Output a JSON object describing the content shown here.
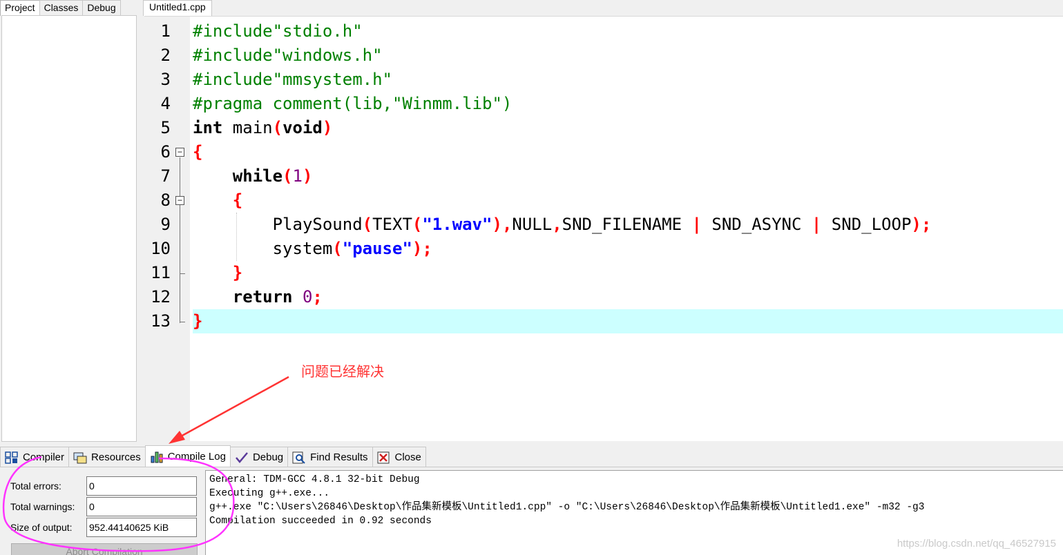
{
  "left_tabs": [
    "Project",
    "Classes",
    "Debug"
  ],
  "file_tab": "Untitled1.cpp",
  "editor": {
    "line_numbers": [
      "1",
      "2",
      "3",
      "4",
      "5",
      "6",
      "7",
      "8",
      "9",
      "10",
      "11",
      "12",
      "13"
    ]
  },
  "annotation": "问题已经解决",
  "bottom_tabs": [
    "Compiler",
    "Resources",
    "Compile Log",
    "Debug",
    "Find Results",
    "Close"
  ],
  "stats": {
    "errors_label": "Total errors:",
    "errors_value": "0",
    "warnings_label": "Total warnings:",
    "warnings_value": "0",
    "output_label": "Size of output:",
    "output_value": "952.44140625 KiB",
    "abort_label": "Abort Compilation"
  },
  "log": {
    "line1": "General: TDM-GCC 4.8.1 32-bit Debug",
    "line2": "Executing g++.exe...",
    "line3": "g++.exe \"C:\\Users\\26846\\Desktop\\作品集新模板\\Untitled1.cpp\" -o \"C:\\Users\\26846\\Desktop\\作品集新模板\\Untitled1.exe\" -m32 -g3",
    "line4": "Compilation succeeded in 0.92 seconds"
  },
  "watermark": "https://blog.csdn.net/qq_46527915",
  "colors": {
    "current_line": "#ccffff",
    "preprocessor": "#008000",
    "symbol": "#ff0000",
    "string": "#0000ff",
    "annotation": "#ff3333",
    "circle": "#ff33ff"
  }
}
